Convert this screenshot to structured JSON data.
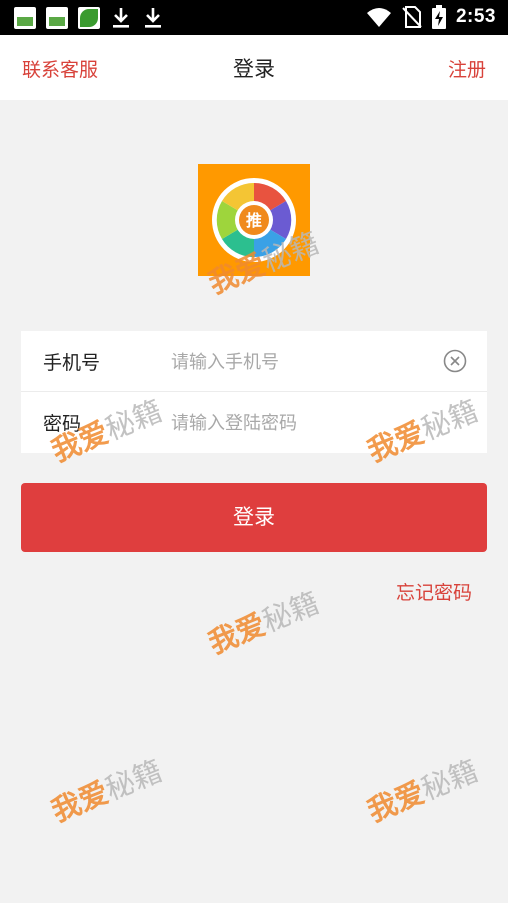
{
  "status_bar": {
    "time": "2:53",
    "icons": [
      "gallery-icon",
      "gallery-icon",
      "leaf-app-icon",
      "download-icon",
      "download-icon",
      "wifi-icon",
      "no-sim-icon",
      "battery-charging-icon"
    ]
  },
  "nav": {
    "left_label": "联系客服",
    "title": "登录",
    "right_label": "注册"
  },
  "logo": {
    "badge_text": "推"
  },
  "form": {
    "phone": {
      "label": "手机号",
      "placeholder": "请输入手机号",
      "value": ""
    },
    "password": {
      "label": "密码",
      "placeholder": "请输入登陆密码",
      "value": ""
    }
  },
  "login_button": "登录",
  "forgot_password": "忘记密码",
  "watermark": {
    "part1": "我爱",
    "part2": "秘籍"
  },
  "colors": {
    "accent": "#d8423a",
    "button": "#df3e3e",
    "logo_bg": "#ff9900",
    "background": "#f2f2f2"
  }
}
